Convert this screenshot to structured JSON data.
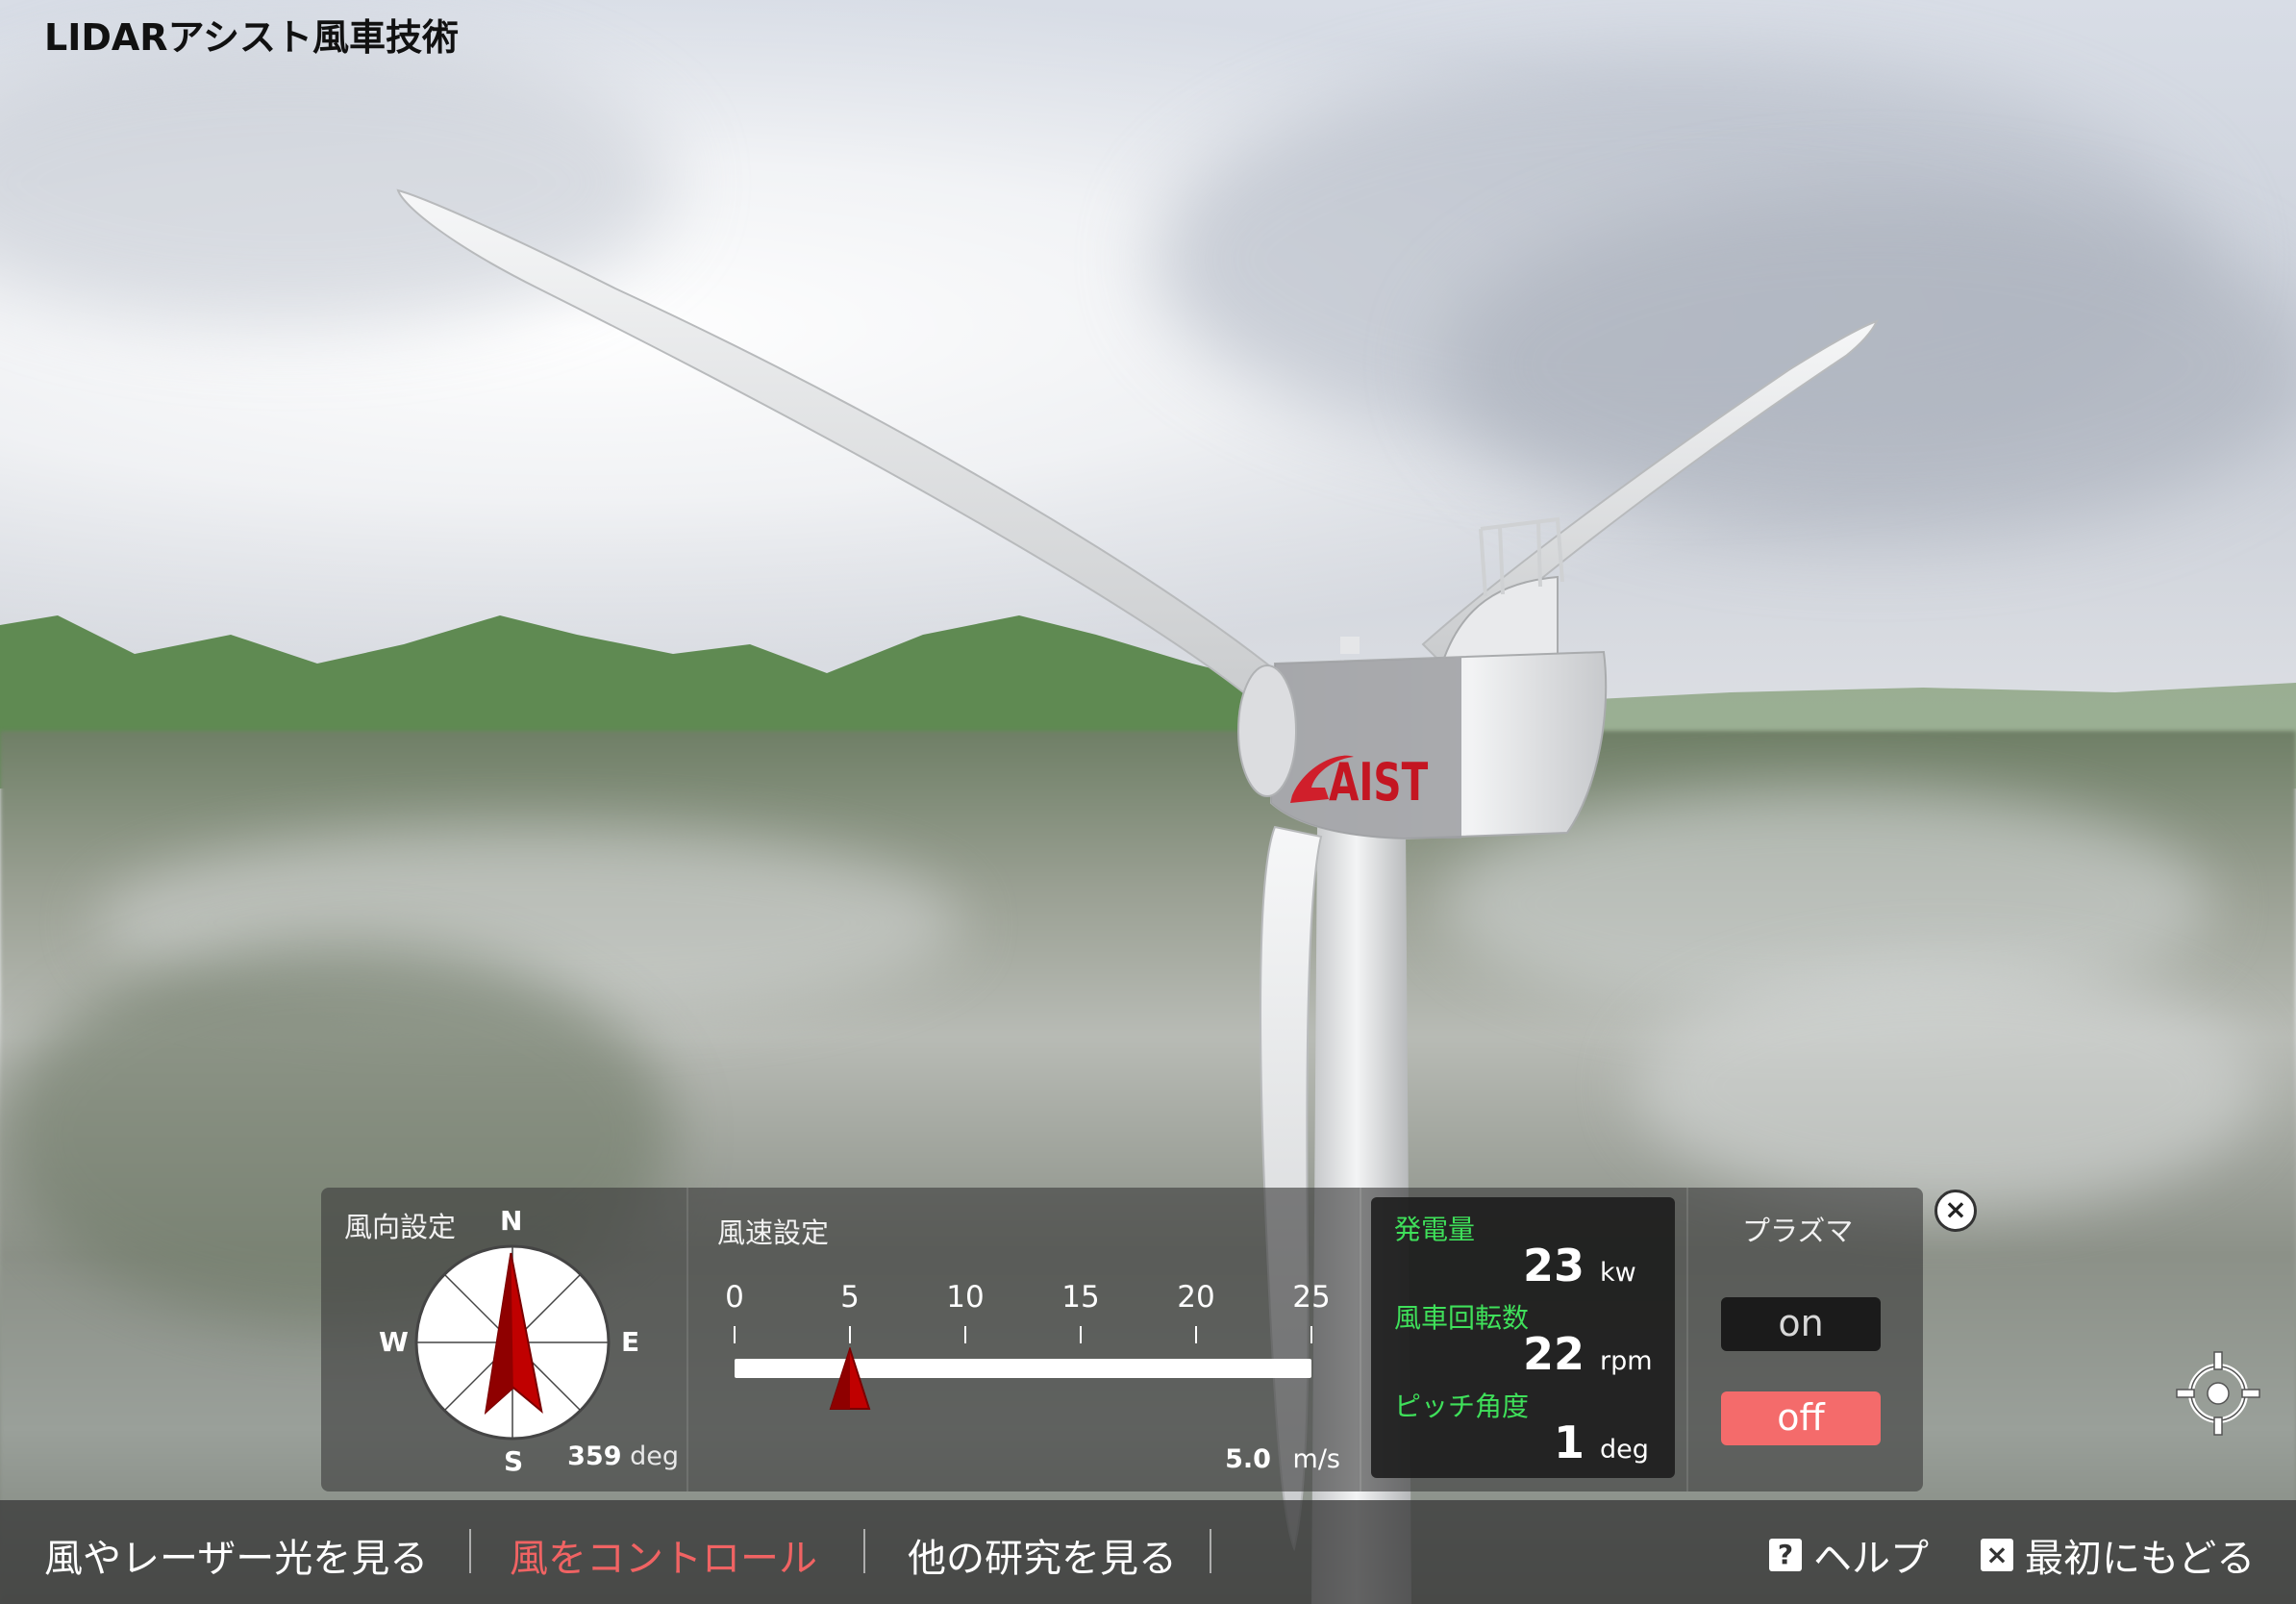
{
  "app": {
    "title": "LIDARアシスト風車技術"
  },
  "turbine": {
    "logo_text": "AIST"
  },
  "wind_direction": {
    "label": "風向設定",
    "north": "N",
    "south": "S",
    "east": "E",
    "west": "W",
    "value": 359,
    "unit": "deg"
  },
  "wind_speed": {
    "label": "風速設定",
    "ticks": [
      "0",
      "5",
      "10",
      "15",
      "20",
      "25"
    ],
    "value": 5.0,
    "value_text": "5.0",
    "unit": "m/s",
    "min": 0,
    "max": 25
  },
  "stats": {
    "power_label": "発電量",
    "power_value": "23",
    "power_unit": "kw",
    "rotation_label": "風車回転数",
    "rotation_value": "22",
    "rotation_unit": "rpm",
    "pitch_label": "ピッチ角度",
    "pitch_value": "1",
    "pitch_unit": "deg"
  },
  "plasma": {
    "label": "プラズマ",
    "on_label": "on",
    "off_label": "off",
    "selected": "off"
  },
  "close_label": "×",
  "nav": {
    "items": [
      {
        "label": "風やレーザー光を見る",
        "active": false
      },
      {
        "label": "風をコントロール",
        "active": true
      },
      {
        "label": "他の研究を見る",
        "active": false
      }
    ],
    "help_icon_text": "?",
    "help_label": "ヘルプ",
    "home_icon_text": "×",
    "home_label": "最初にもどる"
  },
  "colors": {
    "active_nav": "#f06363",
    "stat_label": "#3fe05a",
    "plasma_off": "#f46b6b",
    "needle": "#c00000"
  }
}
